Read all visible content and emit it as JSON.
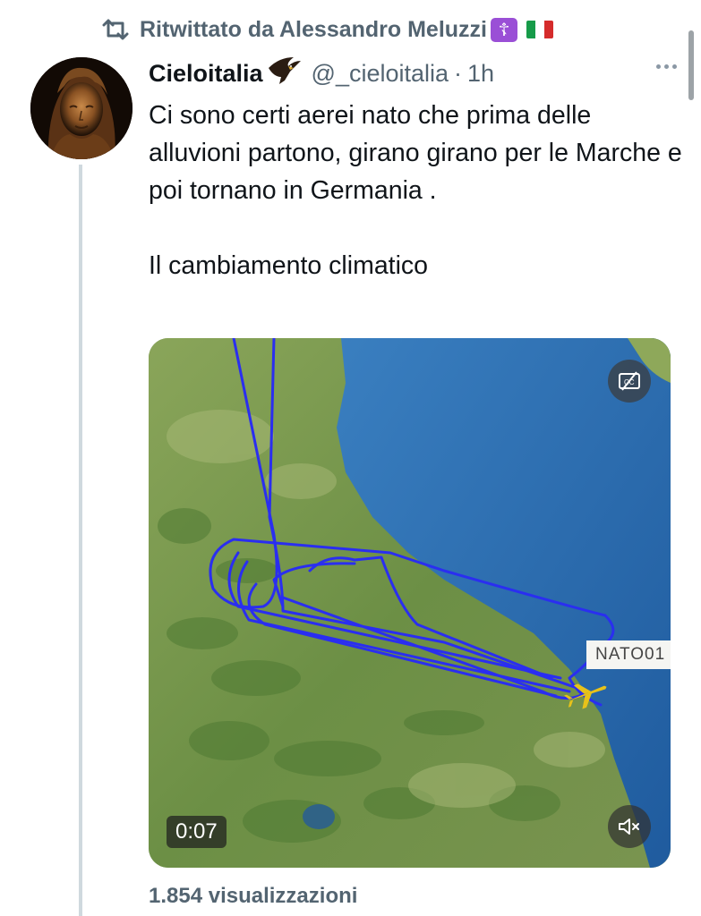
{
  "retweet": {
    "text": "Ritwittato da Alessandro Meluzzi",
    "badge_glyph": "☦"
  },
  "tweet": {
    "display_name": "Cieloitalia",
    "handle": "@_cieloitalia",
    "separator": "·",
    "time": "1h",
    "text_lines": [
      "Ci sono certi aerei nato che prima delle alluvioni partono, girano girano per le Marche e poi tornano in Germania .",
      "Il cambiamento climatico"
    ]
  },
  "media": {
    "type": "video",
    "elapsed": "0:07",
    "flight_label": "NATO01",
    "cc_icon": "closed-captions-icon",
    "mute_icon": "muted-speaker-icon"
  },
  "views": "1.854 visualizzazioni",
  "colors": {
    "secondary_text": "#536471",
    "flight_path": "#2a2ef0",
    "sea": "#2f6db1",
    "land": "#6f8f4a",
    "aircraft": "#e8c21a"
  }
}
